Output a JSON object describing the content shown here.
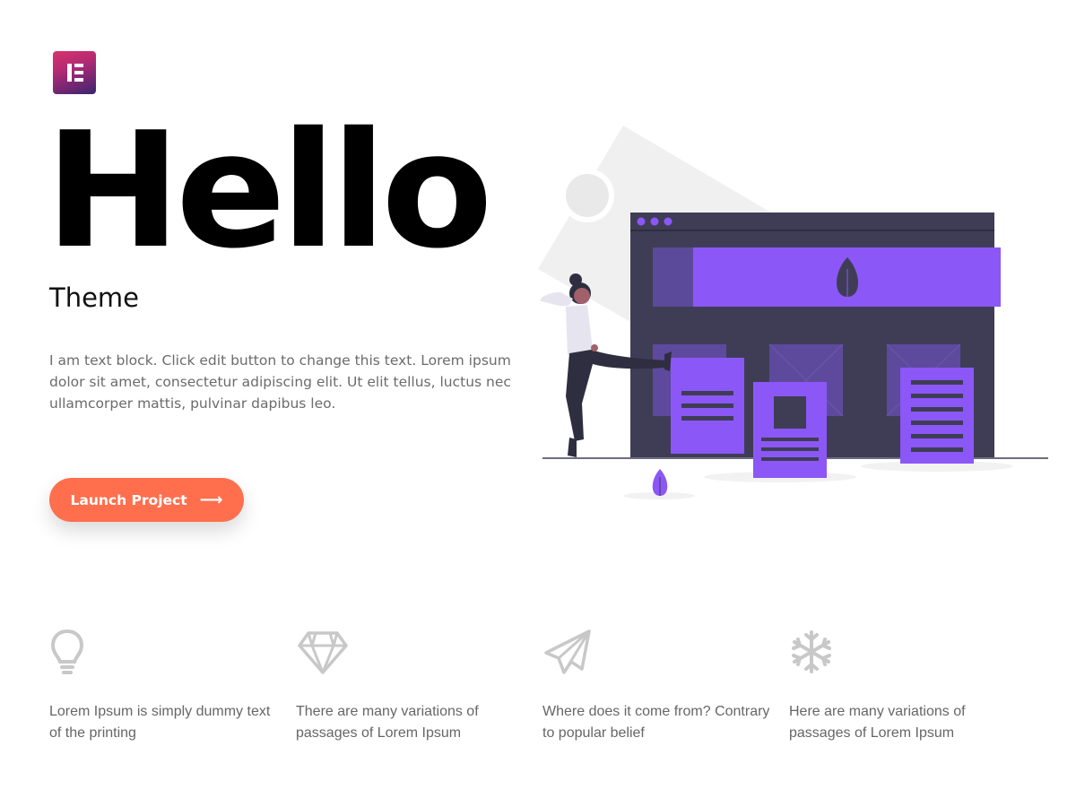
{
  "colors": {
    "accent_button": "#ff6f4d",
    "illustration_purple": "#8c57f7",
    "illustration_dark": "#3f3d56",
    "icon_gray": "#c8c8c8"
  },
  "logo": {
    "icon": "elementor-logo-icon"
  },
  "hero": {
    "title": "Hello",
    "subtitle": "Theme",
    "text": "I am text block. Click edit button to change this text. Lorem ipsum dolor sit amet, consectetur adipiscing elit. Ut elit tellus, luctus nec ullamcorper mattis, pulvinar dapibus leo.",
    "cta_label": "Launch Project",
    "cta_icon": "arrow-right-icon",
    "cta_arrow": "⟶"
  },
  "features": [
    {
      "icon": "lightbulb-icon",
      "text": "Lorem Ipsum is simply dummy text of the printing"
    },
    {
      "icon": "diamond-icon",
      "text": "There are many variations of passages of Lorem Ipsum"
    },
    {
      "icon": "paper-plane-icon",
      "text": "Where does it come from? Contrary to popular belief"
    },
    {
      "icon": "snowflake-icon",
      "text": "Here are many variations of passages of Lorem Ipsum"
    }
  ]
}
